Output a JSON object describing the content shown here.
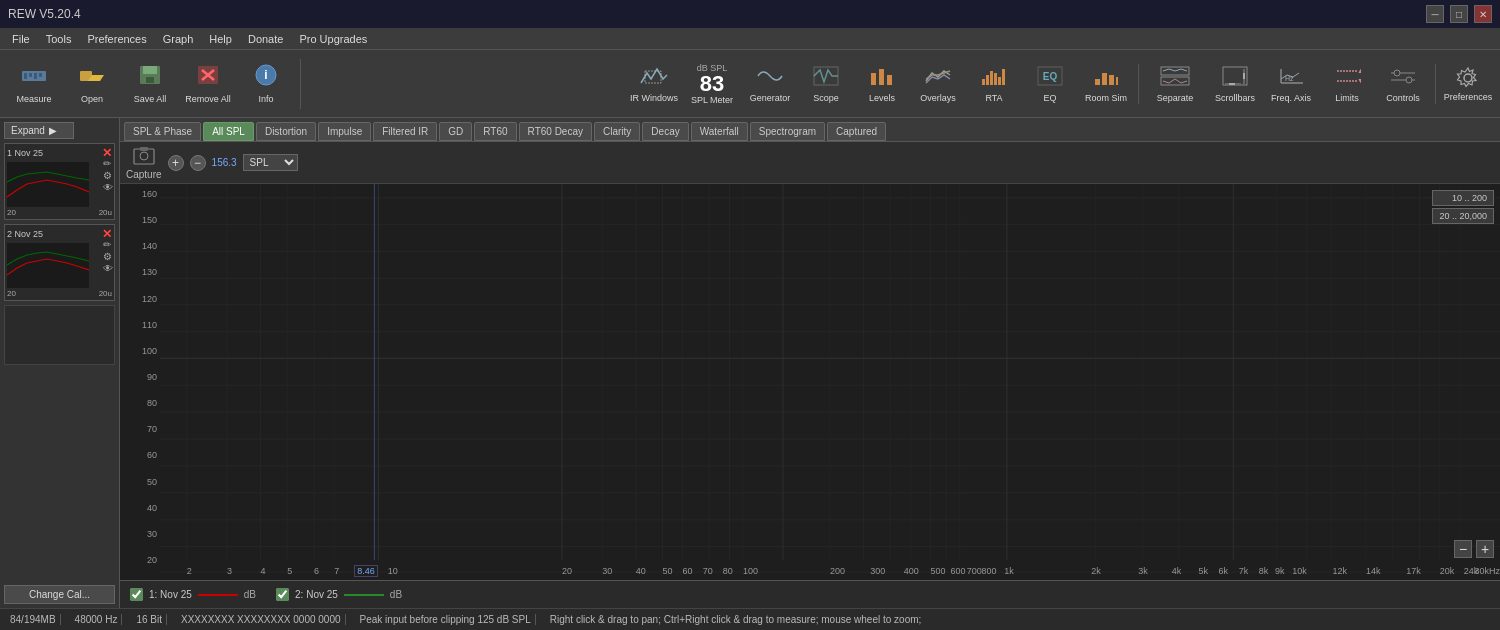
{
  "app": {
    "title": "REW V5.20.4",
    "version": "REW V5.20.4"
  },
  "title_bar": {
    "title": "REW V5.20.4",
    "minimize": "─",
    "maximize": "□",
    "close": "✕"
  },
  "menu": {
    "items": [
      "File",
      "Tools",
      "Preferences",
      "Graph",
      "Help",
      "Donate",
      "Pro Upgrades"
    ]
  },
  "toolbar": {
    "measure_label": "Measure",
    "open_label": "Open",
    "save_all_label": "Save All",
    "remove_all_label": "Remove All",
    "info_label": "Info"
  },
  "right_toolbar": {
    "ir_windows_label": "IR Windows",
    "spl_meter_label": "SPL Meter",
    "spl_value": "83",
    "spl_db": "dB SPL",
    "generator_label": "Generator",
    "scope_label": "Scope",
    "levels_label": "Levels",
    "overlays_label": "Overlays",
    "rta_label": "RTA",
    "eq_label": "EQ",
    "room_sim_label": "Room Sim",
    "preferences_label": "Preferences"
  },
  "secondary_toolbar": {
    "separate_label": "Separate",
    "scrollbars_label": "Scrollbars",
    "freq_axis_label": "Freq. Axis",
    "limits_label": "Limits",
    "controls_label": "Controls"
  },
  "tabs": [
    {
      "id": "spl-phase",
      "label": "SPL & Phase",
      "active": false
    },
    {
      "id": "all-spl",
      "label": "All SPL",
      "active": true
    },
    {
      "id": "distortion",
      "label": "Distortion",
      "active": false
    },
    {
      "id": "impulse",
      "label": "Impulse",
      "active": false
    },
    {
      "id": "filtered-ir",
      "label": "Filtered IR",
      "active": false
    },
    {
      "id": "gd",
      "label": "GD",
      "active": false
    },
    {
      "id": "rt60",
      "label": "RT60",
      "active": false
    },
    {
      "id": "rt60-decay",
      "label": "RT60 Decay",
      "active": false
    },
    {
      "id": "clarity",
      "label": "Clarity",
      "active": false
    },
    {
      "id": "decay",
      "label": "Decay",
      "active": false
    },
    {
      "id": "waterfall",
      "label": "Waterfall",
      "active": false
    },
    {
      "id": "spectrogram",
      "label": "Spectrogram",
      "active": false
    },
    {
      "id": "captured",
      "label": "Captured",
      "active": false
    }
  ],
  "chart_toolbar": {
    "capture_label": "Capture",
    "spl_label": "SPL",
    "zoom_in": "+",
    "zoom_out": "-",
    "freq_input": "8.46",
    "freq_value": "156.3"
  },
  "measurements": [
    {
      "id": "meas-1",
      "label": "1 Nov 25",
      "scale_min": "20",
      "scale_max": "20u",
      "color": "red"
    },
    {
      "id": "meas-2",
      "label": "2 Nov 25",
      "scale_min": "20",
      "scale_max": "20u",
      "color": "red"
    }
  ],
  "y_axis": {
    "labels": [
      "160",
      "150",
      "140",
      "130",
      "120",
      "110",
      "100",
      "90",
      "80",
      "70",
      "60",
      "50",
      "40",
      "30",
      "20"
    ]
  },
  "x_axis": {
    "labels": [
      "2",
      "3",
      "4",
      "5",
      "6",
      "7",
      "8",
      "10",
      "20",
      "30",
      "40",
      "50",
      "60",
      "70",
      "80",
      "100",
      "200",
      "300",
      "400",
      "500",
      "600",
      "700",
      "800",
      "1k",
      "2k",
      "3k",
      "4k",
      "5k",
      "6k",
      "7k",
      "8k",
      "9k",
      "10k",
      "12k",
      "14k",
      "17k",
      "20k",
      "24k",
      "30kHz"
    ]
  },
  "range_buttons": [
    {
      "label": "10 .. 200"
    },
    {
      "label": "20 .. 20,000"
    }
  ],
  "legend": {
    "meas1_label": "1: Nov 25",
    "meas1_db": "dB",
    "meas2_label": "2: Nov 25",
    "meas2_db": "dB"
  },
  "status_bar": {
    "memory": "84/194MB",
    "sample_rate": "48000 Hz",
    "bit_depth": "16 Bit",
    "signal": "XXXXXXXX XXXXXXXX 0000 0000",
    "peak_input": "Peak input before clipping 125 dB SPL",
    "hint": "Right click & drag to pan; Ctrl+Right click & drag to measure; mouse wheel to zoom;"
  },
  "change_cal": {
    "label": "Change Cal..."
  }
}
